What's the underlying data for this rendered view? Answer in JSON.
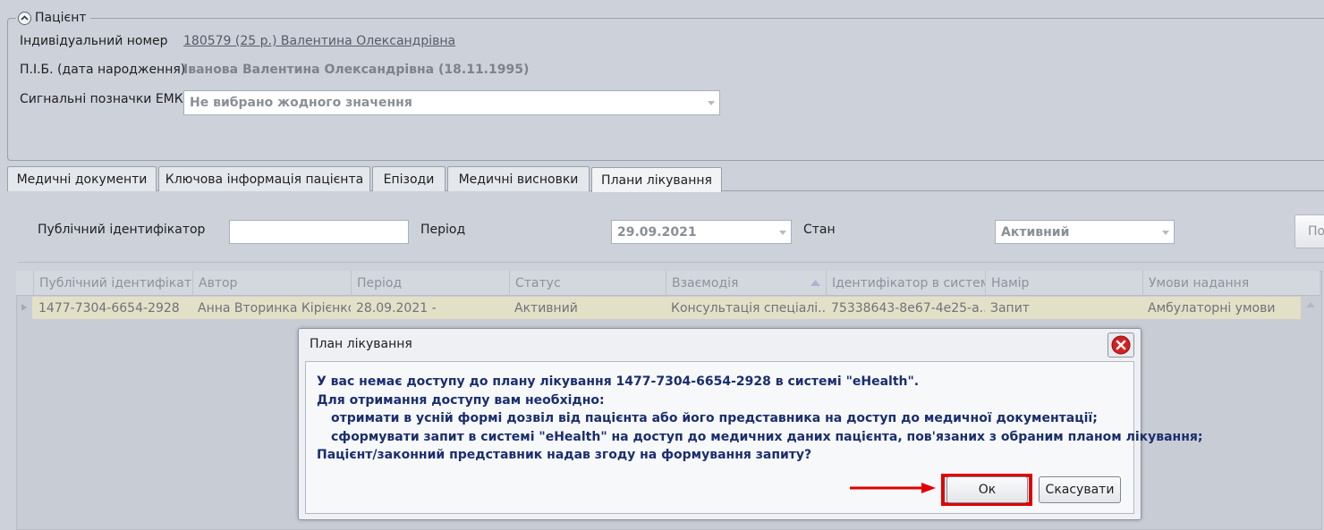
{
  "patient": {
    "group_title": "Пацієнт",
    "id_label": "Індивідуальний номер",
    "id_value": "180579 (25 р.) Валентина Олександрівна",
    "name_label": "П.І.Б. (дата народження)",
    "name_value": "Іванова Валентина Олександрівна (18.11.1995)",
    "flags_label": "Сигнальні позначки ЕМК",
    "flags_placeholder": "Не вибрано жодного значення"
  },
  "tabs": [
    {
      "label": "Медичні документи"
    },
    {
      "label": "Ключова інформація пацієнта"
    },
    {
      "label": "Епізоди"
    },
    {
      "label": "Медичні висновки"
    },
    {
      "label": "Плани лікування",
      "active": true
    }
  ],
  "filters": {
    "public_id_label": "Публічний ідентифікатор",
    "public_id_value": "",
    "period_label": "Період",
    "period_value": "29.09.2021",
    "state_label": "Стан",
    "state_value": "Активний",
    "search_label": "По"
  },
  "grid": {
    "columns": [
      "Публічний ідентифікатор",
      "Автор",
      "Період",
      "Статус",
      "Взаємодія",
      "Ідентифікатор в системі",
      "Намір",
      "Умови надання"
    ],
    "rows": [
      [
        "1477-7304-6654-2928",
        "Анна Вторинка Кірієнко",
        "28.09.2021 -",
        "Активний",
        "Консультація спеціалі...",
        "75338643-8e67-4e25-a...",
        "Запит",
        "Амбулаторні умови"
      ]
    ]
  },
  "dialog": {
    "title": "План лікування",
    "lines": [
      "У вас немає доступу до плану лікування 1477-7304-6654-2928 в системі \"eHealth\".",
      "Для отримання доступу вам необхідно:",
      "отримати в усній формі дозвіл від пацієнта або його представника на доступ до медичної документації;",
      "сформувати запит в системі \"eHealth\" на доступ до медичних даних пацієнта, пов'язаних з обраним планом лікування;",
      "Пацієнт/законний представник надав згоду на формування запиту?"
    ],
    "ok_label": "Ок",
    "cancel_label": "Скасувати"
  },
  "colors": {
    "background": "#cdd1da",
    "dialog_text": "#1a2e6e",
    "highlight": "#e00000",
    "row_selected": "#e3e0c8"
  }
}
